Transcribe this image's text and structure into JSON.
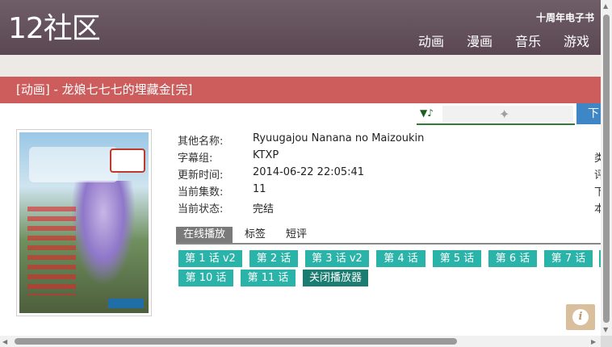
{
  "header": {
    "logo": "12社区",
    "top_link": "十周年电子书",
    "nav": [
      "动画",
      "漫画",
      "音乐",
      "游戏"
    ]
  },
  "title_bar": "[动画] - 龙娘七七七的埋藏金[完]",
  "download_label": "下",
  "player": {
    "note_icon": "▼♪",
    "plugin_icon": "puzzle-icon"
  },
  "info": [
    {
      "label": "其他名称:",
      "value": "Ryuugajou Nanana no Maizoukin"
    },
    {
      "label": "字幕组:",
      "value": "KTXP"
    },
    {
      "label": "更新时间:",
      "value": "2014-06-22 22:05:41"
    },
    {
      "label": "当前集数:",
      "value": "11"
    },
    {
      "label": "当前状态:",
      "value": "完结"
    }
  ],
  "right_clipped": [
    "类",
    "评",
    "下",
    "本"
  ],
  "tabs": [
    "在线播放",
    "标签",
    "短评"
  ],
  "episodes_row1": [
    "第 1 话 v2",
    "第 2 话",
    "第 3 话 v2",
    "第 4 话",
    "第 5 话",
    "第 6 话",
    "第 7 话"
  ],
  "episodes_row2": [
    "第 10 话",
    "第 11 话"
  ],
  "close_player": "关闭播放器",
  "info_float_glyph": "i",
  "scroll_arrows": {
    "up": "▲",
    "down": "▼",
    "left": "◀",
    "right": "▶"
  }
}
